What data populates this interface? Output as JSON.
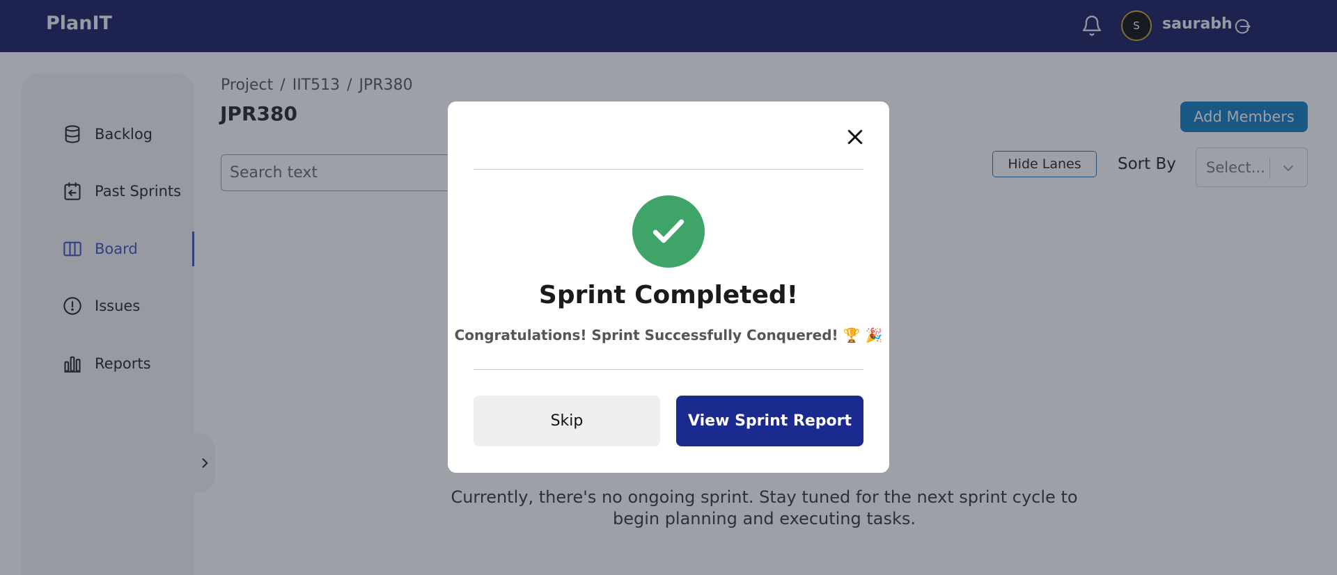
{
  "app": {
    "brand": "PlanIT"
  },
  "header": {
    "username": "saurabh",
    "avatar_initial": "S"
  },
  "sidebar": {
    "items": [
      {
        "label": "Backlog",
        "icon": "database-icon"
      },
      {
        "label": "Past Sprints",
        "icon": "calendar-back-icon"
      },
      {
        "label": "Board",
        "icon": "columns-icon",
        "active": true
      },
      {
        "label": "Issues",
        "icon": "alert-circle-icon"
      },
      {
        "label": "Reports",
        "icon": "bar-chart-icon"
      }
    ]
  },
  "breadcrumb": {
    "items": [
      "Project",
      "IIT513",
      "JPR380"
    ],
    "separator": "/"
  },
  "page": {
    "title": "JPR380"
  },
  "search": {
    "placeholder": "Search text"
  },
  "toolbar": {
    "add_members_label": "Add Members",
    "hide_lanes_label": "Hide Lanes",
    "sort_by_label": "Sort By",
    "sort_select_placeholder": "Select..."
  },
  "empty_state": {
    "message": "Currently, there's no ongoing sprint. Stay tuned for the next sprint cycle to begin planning and executing tasks."
  },
  "modal": {
    "title": "Sprint Completed!",
    "message": "Congratulations! Sprint Successfully Conquered! 🏆 🎉",
    "skip_label": "Skip",
    "report_label": "View Sprint Report"
  },
  "colors": {
    "navbar": "#141c5e",
    "accent": "#3b4fc4",
    "success": "#3fa468",
    "primary_button": "#1b2a8f",
    "add_members": "#0d7bbf"
  }
}
